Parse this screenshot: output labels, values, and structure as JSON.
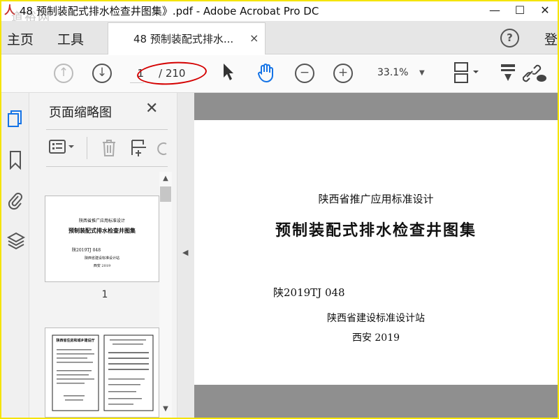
{
  "window": {
    "title": "48 预制装配式排水检查井图集》.pdf - Adobe Acrobat Pro DC",
    "watermark": "道裕网",
    "min_glyph": "—",
    "max_glyph": "☐",
    "close_glyph": "✕"
  },
  "menubar": {
    "home_label": "主页",
    "tools_label": "工具",
    "tab_label": "48 预制装配式排水...",
    "tab_close": "×",
    "help_glyph": "?",
    "signin_label": "登"
  },
  "toolbar": {
    "page_current": "1",
    "page_total": "/ 210",
    "zoom": "33.1%",
    "icons": [
      "prev-page-icon",
      "next-page-icon",
      "select-arrow-icon",
      "hand-tool-icon",
      "zoom-out-icon",
      "zoom-in-icon",
      "page-fit-icon",
      "markup-icon",
      "share-link-icon"
    ]
  },
  "thumbnail_panel": {
    "title": "页面缩略图",
    "close": "✕",
    "thumb1": {
      "line1": "陕西省推广应用标准设计",
      "line2": "预制装配式排水检查井图集",
      "line3": "陕2019TJ 048",
      "line4": "陕西省建设标准设计站",
      "line5": "西安 2019"
    },
    "thumb1_label": "1",
    "thumb2_heading": "陕西省住房和城乡建设厅"
  },
  "document": {
    "subtitle": "陕西省推广应用标准设计",
    "title": "预制装配式排水检查井图集",
    "code": "陕2019TJ 048",
    "publisher": "陕西省建设标准设计站",
    "place_year": "西安 2019"
  },
  "colors": {
    "annotation_ellipse": "#d40000",
    "window_border": "#f5e400"
  }
}
